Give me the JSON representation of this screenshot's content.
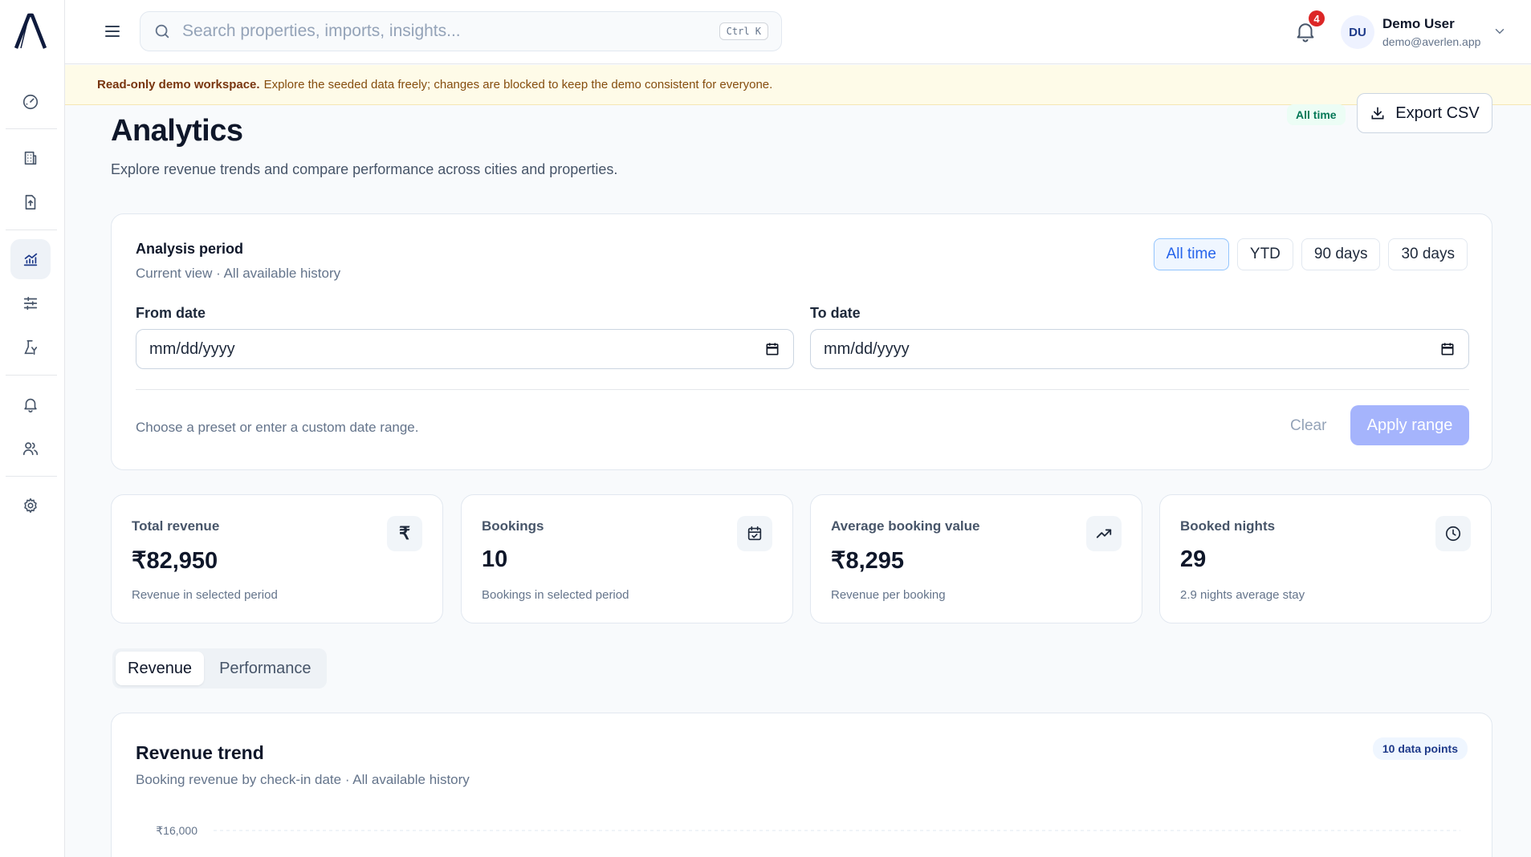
{
  "sidebar": {
    "items": [
      {
        "icon": "dashboard-icon"
      },
      {
        "icon": "building-icon"
      },
      {
        "icon": "file-upload-icon"
      },
      {
        "icon": "analytics-icon",
        "active": true
      },
      {
        "icon": "sliders-icon"
      },
      {
        "icon": "insights-icon"
      },
      {
        "icon": "bell-icon"
      },
      {
        "icon": "users-icon"
      },
      {
        "icon": "settings-icon"
      }
    ]
  },
  "topbar": {
    "search_placeholder": "Search properties, imports, insights...",
    "shortcut": "Ctrl K",
    "notification_count": "4",
    "user": {
      "initials": "DU",
      "name": "Demo User",
      "email": "demo@averlen.app"
    }
  },
  "banner": {
    "title": "Read-only demo workspace.",
    "text": "Explore the seeded data freely; changes are blocked to keep the demo consistent for everyone."
  },
  "page": {
    "title": "Analytics",
    "subtitle": "Explore revenue trends and compare performance across cities and properties.",
    "period_pill": "All time",
    "export_label": "Export CSV"
  },
  "period_card": {
    "title": "Analysis period",
    "subtitle": "Current view · All available history",
    "presets": [
      {
        "label": "All time",
        "active": true
      },
      {
        "label": "YTD",
        "active": false
      },
      {
        "label": "90 days",
        "active": false
      },
      {
        "label": "30 days",
        "active": false
      }
    ],
    "from_label": "From date",
    "to_label": "To date",
    "date_placeholder": "mm/dd/yyyy",
    "hint": "Choose a preset or enter a custom date range.",
    "clear_label": "Clear",
    "apply_label": "Apply range"
  },
  "stats": [
    {
      "label": "Total revenue",
      "value": "₹82,950",
      "note": "Revenue in selected period",
      "icon": "rupee-icon"
    },
    {
      "label": "Bookings",
      "value": "10",
      "note": "Bookings in selected period",
      "icon": "calendar-check-icon"
    },
    {
      "label": "Average booking value",
      "value": "₹8,295",
      "note": "Revenue per booking",
      "icon": "trend-up-icon"
    },
    {
      "label": "Booked nights",
      "value": "29",
      "note": "2.9 nights average stay",
      "icon": "clock-icon"
    }
  ],
  "tabs": [
    {
      "label": "Revenue",
      "active": true
    },
    {
      "label": "Performance",
      "active": false
    }
  ],
  "chart_card": {
    "title": "Revenue trend",
    "subtitle": "Booking revenue by check-in date · All available history",
    "points_badge": "10 data points",
    "y_tick_top": "₹16,000"
  },
  "colors": {
    "accent": "#2563eb",
    "banner_bg": "#fefbe8",
    "apply_disabled": "#a5b4fc",
    "badge_red": "#dc2626"
  }
}
